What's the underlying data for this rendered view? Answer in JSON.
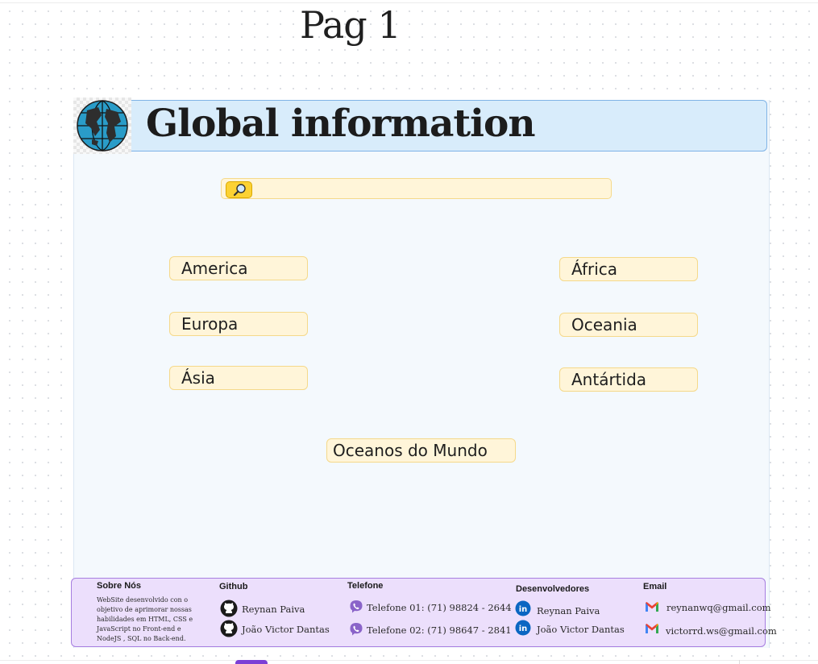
{
  "page": {
    "title": "Pag 1"
  },
  "header": {
    "title": "Global information",
    "logo_icon": "globe-icon"
  },
  "search": {
    "placeholder": "",
    "value": "",
    "button_icon": "magnifier-icon"
  },
  "continents": [
    {
      "label": "America"
    },
    {
      "label": "África"
    },
    {
      "label": "Europa"
    },
    {
      "label": "Oceania"
    },
    {
      "label": "Ásia"
    },
    {
      "label": "Antártida"
    }
  ],
  "oceans_button": {
    "label": "Oceanos do Mundo"
  },
  "footer": {
    "about": {
      "heading": "Sobre Nós",
      "text": "WebSite desenvolvido con o objetivo de aprimorar nossas habilidades em HTML, CSS e JavaScript no Front-end e NodeJS , SQL no Back-end."
    },
    "github": {
      "heading": "Github",
      "icon": "github-icon",
      "items": [
        {
          "label": "Reynan Paiva"
        },
        {
          "label": "João Victor Dantas"
        }
      ]
    },
    "phone": {
      "heading": "Telefone",
      "icon": "viber-icon",
      "items": [
        {
          "label": "Telefone 01: (71) 98824 - 2644"
        },
        {
          "label": "Telefone 02: (71) 98647 - 2841"
        }
      ]
    },
    "developers": {
      "heading": "Desenvolvedores",
      "icon": "linkedin-icon",
      "items": [
        {
          "label": "Reynan Paiva"
        },
        {
          "label": "João Victor Dantas"
        }
      ]
    },
    "email": {
      "heading": "Email",
      "icon": "gmail-icon",
      "items": [
        {
          "label": "reynanwq@gmail.com"
        },
        {
          "label": "victorrd.ws@gmail.com"
        }
      ]
    }
  },
  "colors": {
    "header_bg": "#d8ecfb",
    "pill_bg": "#fff5d9",
    "pill_border": "#f5d98a",
    "search_button": "#fcd233",
    "footer_bg": "#ecdffc",
    "footer_border": "#a77ee0"
  }
}
